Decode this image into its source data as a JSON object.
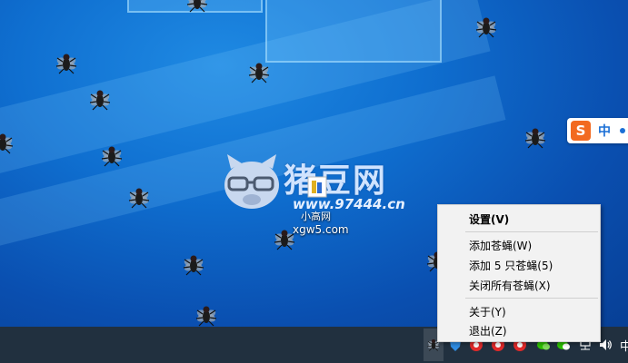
{
  "desktop": {
    "watermark": {
      "title": "猪豆网",
      "url": "www.97444.cn"
    },
    "app_icon_label": "小高网",
    "site_url": "xgw5.com"
  },
  "ime": {
    "logo": "S",
    "language": "中"
  },
  "context_menu": {
    "items": [
      {
        "label": "设置(V)",
        "bold": true
      },
      {
        "label": "添加苍蝇(W)"
      },
      {
        "label": "添加 5 只苍蝇(5)"
      },
      {
        "label": "关闭所有苍蝇(X)"
      },
      {
        "label": "关于(Y)"
      },
      {
        "label": "退出(Z)"
      }
    ]
  },
  "taskbar": {
    "tray_icons": [
      "fly-icon",
      "shield-icon",
      "red-app-icon",
      "red-app-icon",
      "red-app-icon",
      "red-app-icon",
      "wechat-icon",
      "wechat-icon",
      "network-icon",
      "volume-icon"
    ],
    "ime_indicator": "中"
  },
  "colors": {
    "desktop": "#0f6fd0",
    "taskbar": "#21303f",
    "menu": "#f2f2f2",
    "sogou": "#f26a21"
  }
}
